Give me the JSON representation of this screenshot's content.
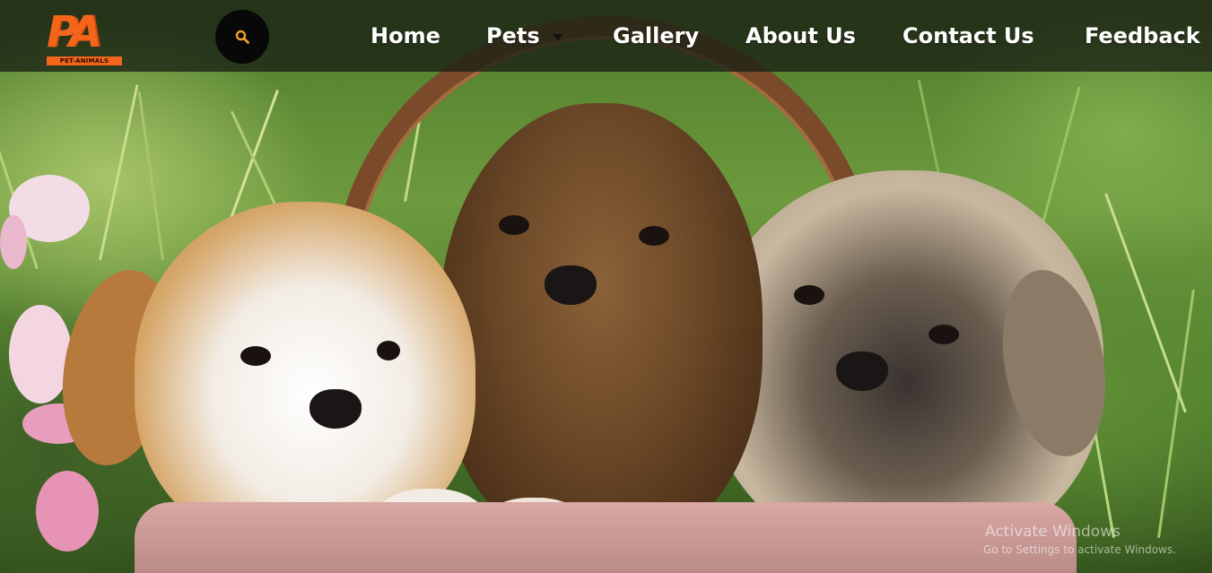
{
  "logo": {
    "mark": "PA",
    "tagline": "PET-ANIMALS",
    "brand_color": "#f4641b"
  },
  "search": {
    "icon": "search-icon",
    "icon_color": "#f0a028"
  },
  "nav": {
    "items": [
      {
        "label": "Home"
      },
      {
        "label": "Pets",
        "has_dropdown": true
      },
      {
        "label": "Gallery"
      },
      {
        "label": "About Us"
      },
      {
        "label": "Contact Us"
      },
      {
        "label": "Feedback"
      }
    ]
  },
  "hero": {
    "image": "three-puppies-in-basket"
  },
  "watermark": {
    "title": "Activate Windows",
    "subtitle": "Go to Settings to activate Windows."
  }
}
